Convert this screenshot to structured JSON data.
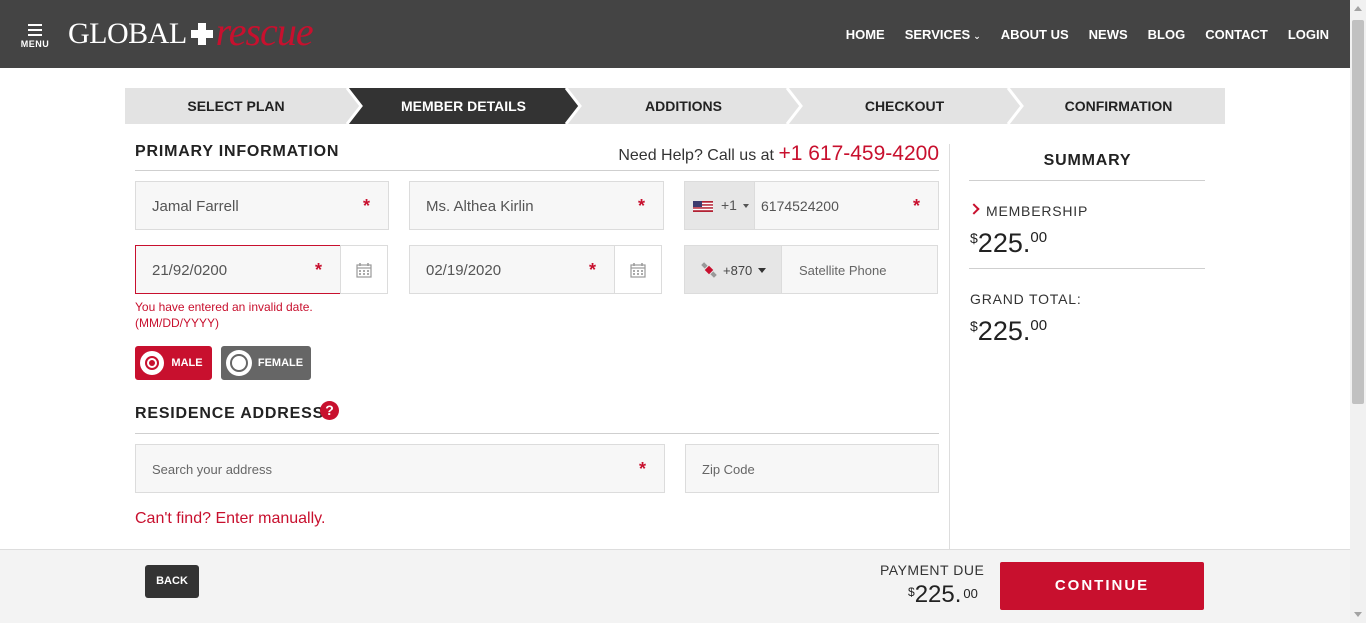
{
  "header": {
    "menu_label": "MENU",
    "logo_word1": "GLOBAL",
    "logo_word2": "rescue",
    "nav": [
      "HOME",
      "SERVICES",
      "ABOUT US",
      "NEWS",
      "BLOG",
      "CONTACT",
      "LOGIN"
    ]
  },
  "steps": [
    {
      "label": "SELECT PLAN",
      "active": false
    },
    {
      "label": "MEMBER DETAILS",
      "active": true
    },
    {
      "label": "ADDITIONS",
      "active": false
    },
    {
      "label": "CHECKOUT",
      "active": false
    },
    {
      "label": "CONFIRMATION",
      "active": false
    }
  ],
  "primary": {
    "title": "PRIMARY INFORMATION",
    "help_text": "Need Help? Call us at",
    "help_phone": "+1 617-459-4200",
    "name_value": "Jamal Farrell",
    "contact_value": "Ms. Althea Kirlin",
    "phone_country_code": "+1",
    "phone_value": "6174524200",
    "dob_value": "21/92/0200",
    "date2_value": "02/19/2020",
    "dob_error_line1": "You have entered an invalid date.",
    "dob_error_line2": "(MM/DD/YYYY)",
    "sat_country_code": "+870",
    "sat_placeholder": "Satellite Phone",
    "gender_male": "MALE",
    "gender_female": "FEMALE",
    "gender_selected": "MALE"
  },
  "residence": {
    "title": "RESIDENCE ADDRESS",
    "help_icon": "?",
    "address_placeholder": "Search your address",
    "zip_placeholder": "Zip Code",
    "manual_link": "Can't find? Enter manually."
  },
  "summary": {
    "title": "SUMMARY",
    "membership_label": "MEMBERSHIP",
    "membership_currency": "$",
    "membership_dollars": "225.",
    "membership_cents": "00",
    "grand_label": "GRAND TOTAL:",
    "grand_currency": "$",
    "grand_dollars": "225.",
    "grand_cents": "00"
  },
  "footer": {
    "back_label": "BACK",
    "payment_due_label": "PAYMENT DUE",
    "payment_currency": "$",
    "payment_dollars": "225.",
    "payment_cents": "00",
    "continue_label": "CONTINUE"
  },
  "colors": {
    "brand_red": "#c8102e",
    "header_bg": "#444444",
    "step_active": "#333333",
    "step_inactive": "#e3e3e3"
  },
  "icons": {
    "menu": "hamburger-icon",
    "calendar": "calendar-icon",
    "flag": "us-flag-icon",
    "satellite": "satellite-icon",
    "help": "question-circle-icon",
    "chevron": "chevron-right-icon"
  }
}
